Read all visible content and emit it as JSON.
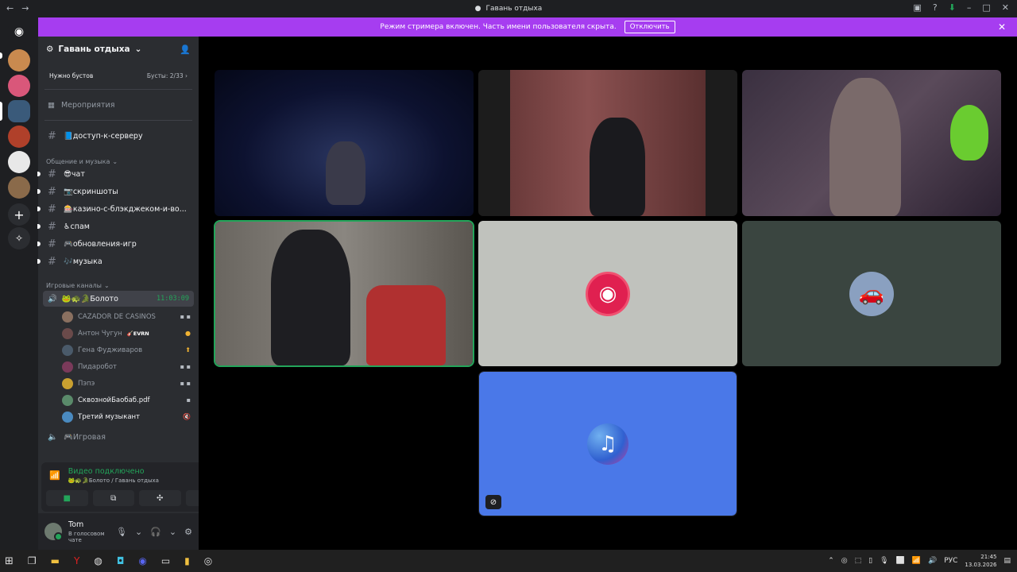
{
  "window": {
    "title": "Гавань отдыха"
  },
  "banner": {
    "text": "Режим стримера включен. Часть имени пользователя скрыта.",
    "button": "Отключить"
  },
  "server": {
    "name": "Гавань отдыха",
    "boost_label": "Нужно бустов",
    "boost_count": "Бусты: 2/33 ›",
    "events": "Мероприятия"
  },
  "channels": {
    "top": {
      "label": "📘доступ-к-серверу"
    },
    "cat1": "Общение и музыка",
    "list": [
      {
        "label": "😎чат"
      },
      {
        "label": "📷скриншоты"
      },
      {
        "label": "🎰казино-с-блэкджеком-и-во..."
      },
      {
        "label": "♿спам"
      },
      {
        "label": "🎮обновления-игр"
      },
      {
        "label": "🎶музыка"
      }
    ],
    "cat2": "Игровые каналы",
    "voice": {
      "label": "🐸🐢🐊Болото",
      "time": "11:03:09"
    },
    "voice_users": [
      {
        "name": "CAZADOR DE CASINOS",
        "status": "▪ ▪"
      },
      {
        "name": "Антон Чугун",
        "tag": "🎸EVRN",
        "status": "●"
      },
      {
        "name": "Гена Фудживаров",
        "status": "⬆"
      },
      {
        "name": "Пидаробот",
        "status": "▪ ▪"
      },
      {
        "name": "Пэпэ",
        "status": "▪ ▪"
      },
      {
        "name": "СквознойБаобаб.pdf",
        "status": "▪"
      },
      {
        "name": "Третий музыкант",
        "status": "🔇"
      }
    ],
    "voice2": {
      "label": "🎮Игровая"
    }
  },
  "voice_panel": {
    "status": "Видео подключено",
    "sub": "🐸🐢🐊Болото / Гавань отдыха"
  },
  "user": {
    "name": "Tom",
    "status": "В голосовом чате"
  },
  "taskbar": {
    "lang": "РУС",
    "time": "21:45",
    "date": "13.03.2026"
  },
  "colors": {
    "accent": "#a63df0",
    "online": "#23a55a",
    "blurple": "#5865f2"
  }
}
